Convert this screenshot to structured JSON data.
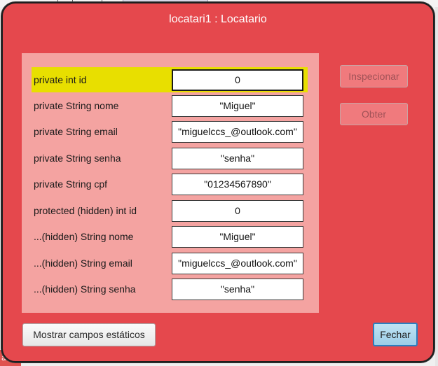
{
  "background": {
    "bottom_fragment": "a."
  },
  "dialog": {
    "title": "locatari1 : Locatario",
    "accent_color": "#e5484d",
    "panel_color": "#f4a3a1",
    "selected_color": "#e8df00"
  },
  "fields": [
    {
      "label": "private int id",
      "value": "0",
      "selected": true
    },
    {
      "label": "private String nome",
      "value": "\"Miguel\""
    },
    {
      "label": "private String email",
      "value": "\"miguelccs_@outlook.com\""
    },
    {
      "label": "private String senha",
      "value": "\"senha\""
    },
    {
      "label": "private String cpf",
      "value": "\"01234567890\""
    },
    {
      "label": "protected (hidden) int id",
      "value": "0"
    },
    {
      "label": "...(hidden) String nome",
      "value": "\"Miguel\""
    },
    {
      "label": "...(hidden) String email",
      "value": "\"miguelccs_@outlook.com\""
    },
    {
      "label": "...(hidden) String senha",
      "value": "\"senha\""
    }
  ],
  "buttons": {
    "inspect_label": "Inspecionar",
    "get_label": "Obter",
    "show_static_label": "Mostrar campos estáticos",
    "close_label": "Fechar"
  }
}
